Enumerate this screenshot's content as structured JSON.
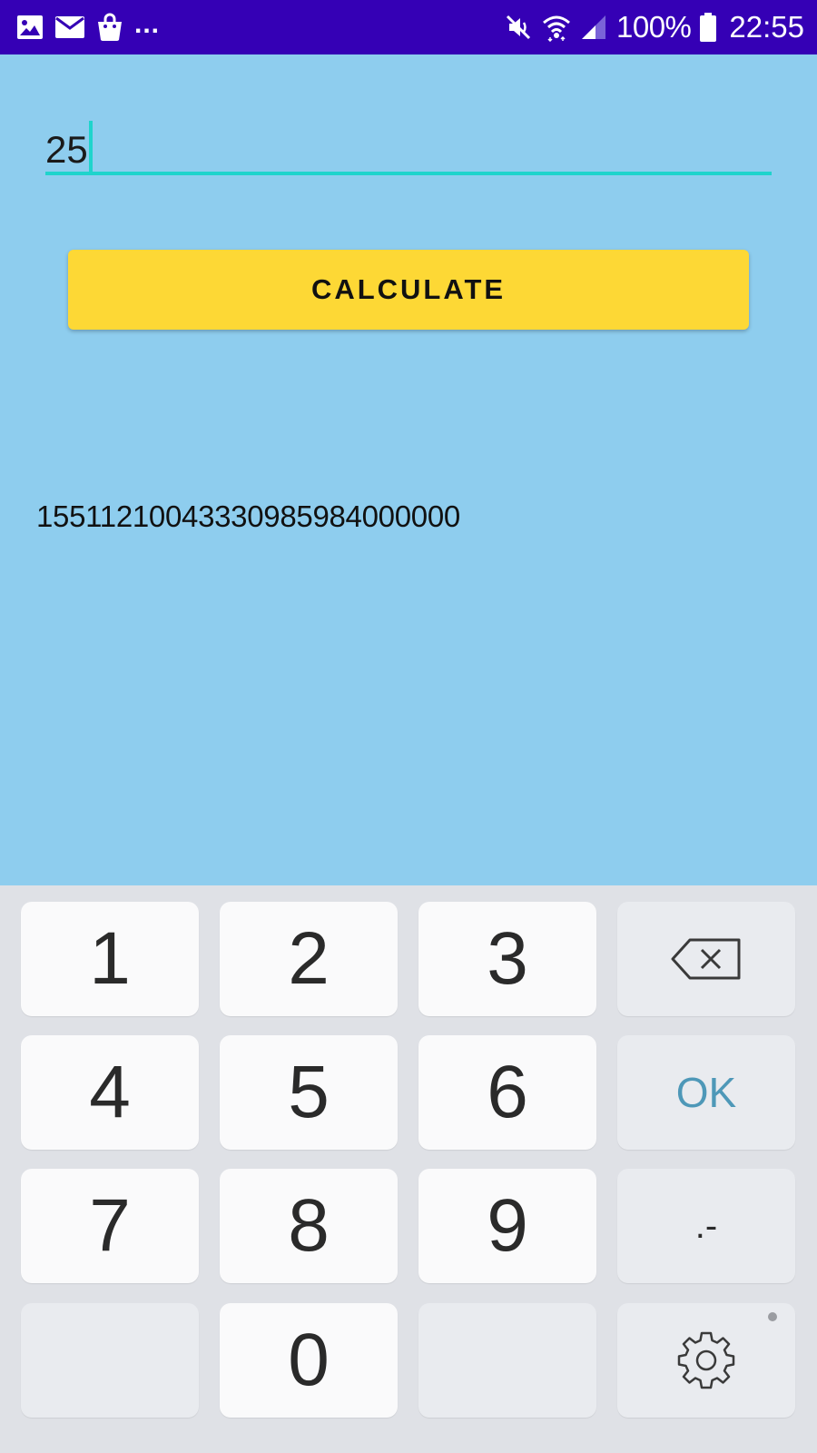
{
  "status_bar": {
    "icons_left": [
      "image-icon",
      "mail-icon",
      "shopping-bag-icon"
    ],
    "more_indicator": "...",
    "icons_right": [
      "mute-icon",
      "wifi-icon",
      "signal-icon",
      "battery-icon"
    ],
    "battery_percent": "100%",
    "time": "22:55",
    "bg_color": "#3500b5"
  },
  "app": {
    "bg_color": "#8ecdee",
    "input": {
      "value": "25",
      "accent_color": "#1fd4cc"
    },
    "calculate_button": {
      "label": "CALCULATE",
      "color": "#fdd835"
    },
    "result": "15511210043330985984000000"
  },
  "keyboard": {
    "bg_color": "#dfe1e6",
    "keys": {
      "k1": "1",
      "k2": "2",
      "k3": "3",
      "k4": "4",
      "k5": "5",
      "k6": "6",
      "k7": "7",
      "k8": "8",
      "k9": "9",
      "k0": "0",
      "ok": "OK",
      "decimal": ".-"
    },
    "backspace_icon": "backspace-icon",
    "settings_icon": "gear-icon",
    "ok_color": "#4e98b8"
  }
}
